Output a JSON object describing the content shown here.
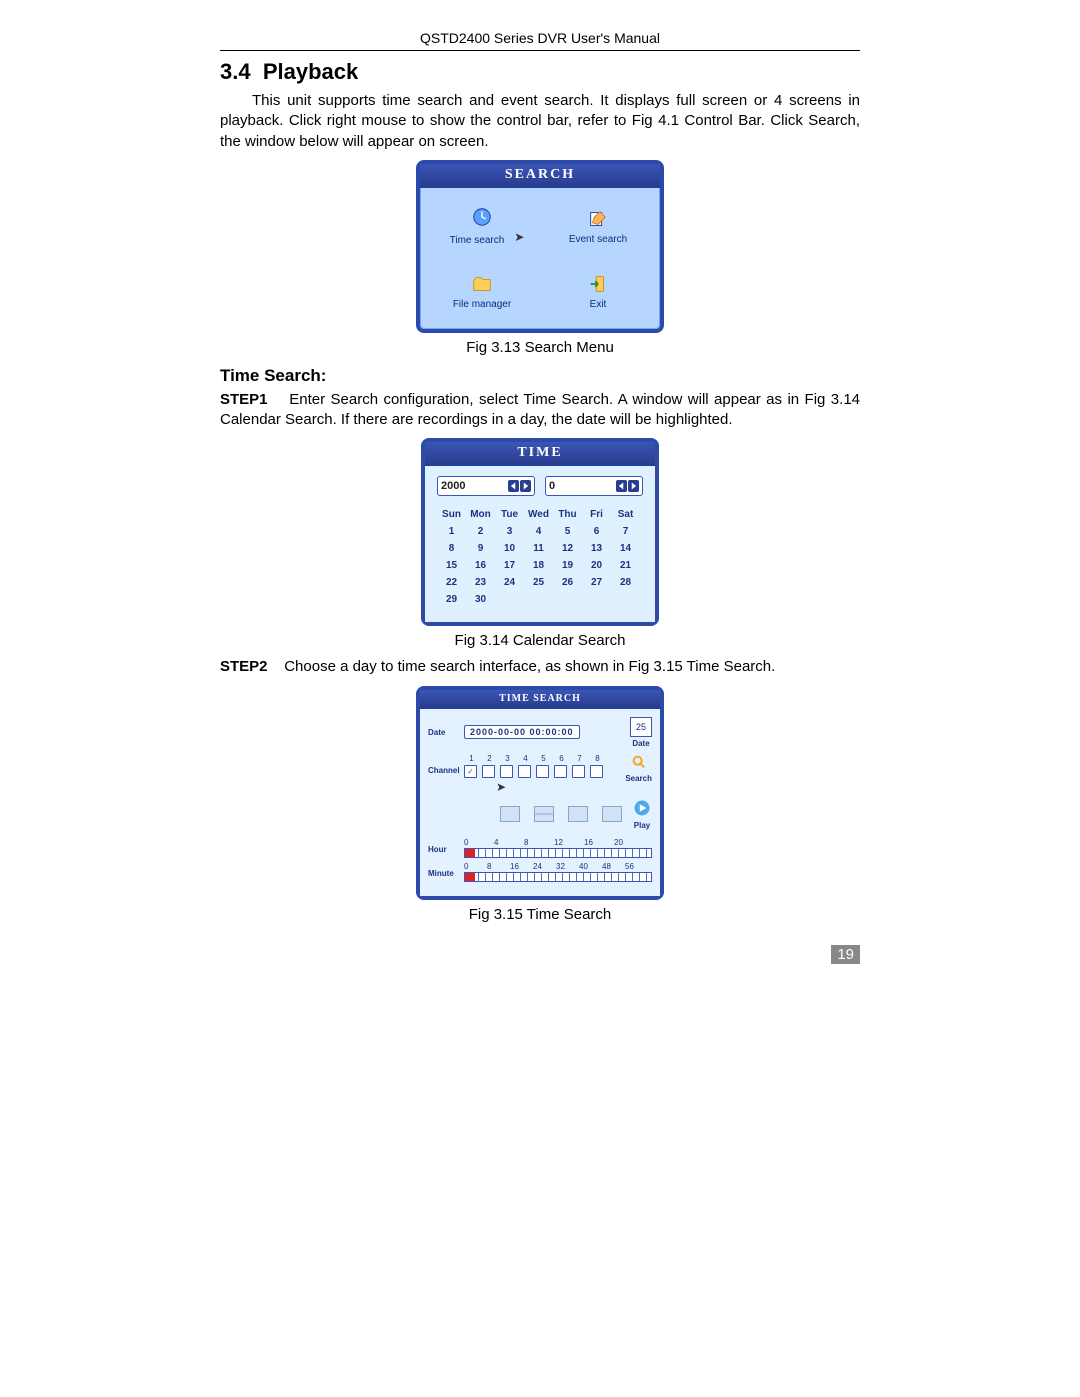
{
  "header": "QSTD2400 Series DVR User's Manual",
  "section_number": "3.4",
  "section_title": "Playback",
  "intro": "This unit supports time search and event search. It displays full screen or 4 screens in playback. Click right mouse to show the control bar, refer to Fig 4.1 Control Bar. Click Search, the window below will appear on screen.",
  "fig313": {
    "title": "SEARCH",
    "items": {
      "ts": "Time search",
      "es": "Event search",
      "fm": "File manager",
      "ex": "Exit"
    },
    "caption": "Fig 3.13    Search Menu"
  },
  "subheading": "Time Search:",
  "step1_label": "STEP1",
  "step1_text": "Enter Search configuration, select Time Search. A window will appear as in Fig 3.14 Calendar Search. If there are recordings in a day, the date will be highlighted.",
  "fig314": {
    "title": "TIME",
    "year": "2000",
    "month": "0",
    "days_header": [
      "Sun",
      "Mon",
      "Tue",
      "Wed",
      "Thu",
      "Fri",
      "Sat"
    ],
    "weeks": [
      [
        "1",
        "2",
        "3",
        "4",
        "5",
        "6",
        "7"
      ],
      [
        "8",
        "9",
        "10",
        "11",
        "12",
        "13",
        "14"
      ],
      [
        "15",
        "16",
        "17",
        "18",
        "19",
        "20",
        "21"
      ],
      [
        "22",
        "23",
        "24",
        "25",
        "26",
        "27",
        "28"
      ],
      [
        "29",
        "30",
        "",
        "",
        "",
        "",
        ""
      ]
    ],
    "caption": "Fig 3.14 Calendar Search"
  },
  "step2_label": "STEP2",
  "step2_text": "Choose a day to time search interface, as shown in Fig 3.15 Time Search.",
  "fig315": {
    "title": "TIME SEARCH",
    "date_label": "Date",
    "date_value": "2000-00-00  00:00:00",
    "channel_label": "Channel",
    "channels": [
      "1",
      "2",
      "3",
      "4",
      "5",
      "6",
      "7",
      "8"
    ],
    "right_icons": {
      "date_num": "25",
      "date_txt": "Date",
      "search_txt": "Search",
      "play_txt": "Play"
    },
    "hour_label": "Hour",
    "hour_ticks": [
      "0",
      "4",
      "8",
      "12",
      "16",
      "20"
    ],
    "minute_label": "Minute",
    "minute_ticks": [
      "0",
      "8",
      "16",
      "24",
      "32",
      "40",
      "48",
      "56"
    ],
    "caption": "Fig 3.15 Time Search"
  },
  "page_number": "19"
}
